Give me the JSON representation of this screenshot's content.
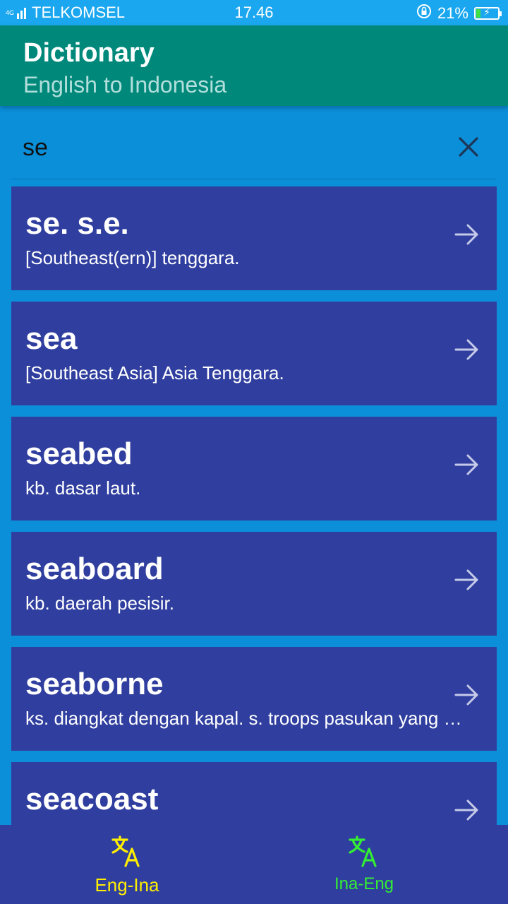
{
  "status_bar": {
    "network": "4G",
    "carrier": "TELKOMSEL",
    "time": "17.46",
    "battery": "21%",
    "battery_level": 0.21
  },
  "app_bar": {
    "title": "Dictionary",
    "subtitle": "English to Indonesia"
  },
  "search": {
    "value": "se",
    "clear_icon": "close-icon"
  },
  "results": [
    {
      "word": "se. s.e.",
      "definition": "[Southeast(ern)] tenggara."
    },
    {
      "word": "sea",
      "definition": "[Southeast Asia] Asia Tenggara."
    },
    {
      "word": "seabed",
      "definition": "kb. dasar laut."
    },
    {
      "word": "seaboard",
      "definition": "kb. daerah pesisir."
    },
    {
      "word": "seaborne",
      "definition": "ks. diangkat dengan kapal. s. troops pasukan yang diangkut dengan kapal laut."
    },
    {
      "word": "seacoast",
      "definition": ""
    }
  ],
  "bottom_nav": {
    "eng_ina": {
      "label": "Eng-Ina",
      "color": "#ffee00",
      "icon": "translate-icon"
    },
    "ina_eng": {
      "label": "Ina-Eng",
      "color": "#33ee33",
      "icon": "translate-icon"
    }
  },
  "colors": {
    "status_bar": "#1aa7ef",
    "app_bar": "#00897b",
    "background": "#0b8fd9",
    "card": "#303f9f",
    "bottom_nav": "#303f9f"
  }
}
